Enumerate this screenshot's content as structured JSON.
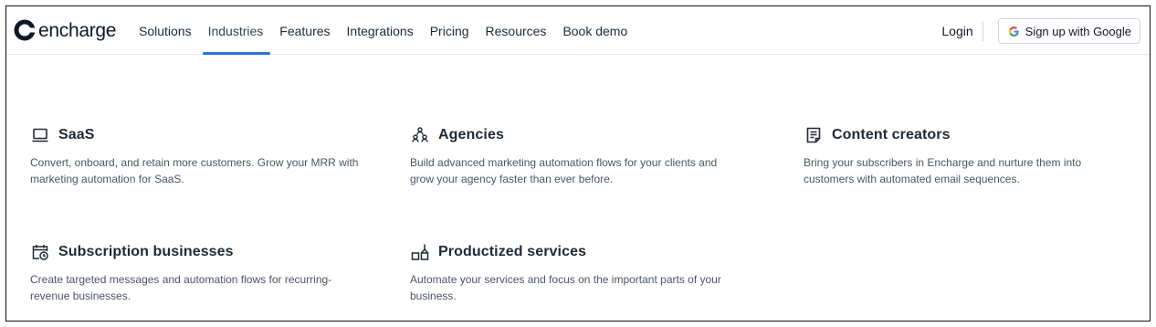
{
  "brand": {
    "logo_text": "encharge",
    "accent_color": "#2f6fd8"
  },
  "nav": {
    "items": [
      {
        "label": "Solutions"
      },
      {
        "label": "Industries",
        "active": true
      },
      {
        "label": "Features"
      },
      {
        "label": "Integrations"
      },
      {
        "label": "Pricing"
      },
      {
        "label": "Resources"
      },
      {
        "label": "Book demo"
      }
    ],
    "login_label": "Login",
    "signup_label": "Sign up with Google"
  },
  "industries": [
    {
      "icon": "laptop-icon",
      "title": "SaaS",
      "desc": "Convert, onboard, and retain more customers. Grow your MRR with marketing automation for SaaS."
    },
    {
      "icon": "agency-people-icon",
      "title": "Agencies",
      "desc": "Build advanced marketing automation flows for your clients and grow your agency faster than ever before."
    },
    {
      "icon": "document-icon",
      "title": "Content creators",
      "desc": "Bring your subscribers in Encharge and nurture them into customers with automated email sequences."
    },
    {
      "icon": "calendar-clock-icon",
      "title": "Subscription businesses",
      "desc": "Create targeted messages and automation flows for recurring-revenue businesses."
    },
    {
      "icon": "productized-blocks-icon",
      "title": "Productized services",
      "desc": "Automate your services and focus on the important parts of your business."
    }
  ]
}
